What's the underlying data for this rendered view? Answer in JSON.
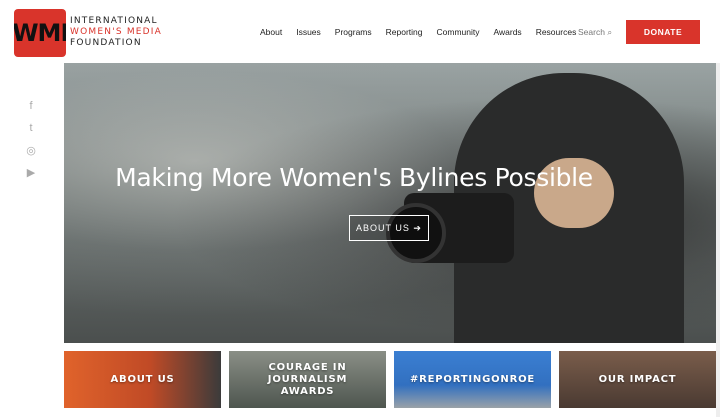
{
  "logo": {
    "letters": "IWMF",
    "line1": "INTERNATIONAL",
    "line2": "WOMEN'S MEDIA",
    "line3": "FOUNDATION"
  },
  "nav": {
    "items": [
      "About",
      "Issues",
      "Programs",
      "Reporting",
      "Community",
      "Awards",
      "Resources"
    ]
  },
  "search": {
    "label": "Search"
  },
  "donate": {
    "label": "DONATE"
  },
  "social": {
    "icons": [
      "facebook-icon",
      "twitter-icon",
      "instagram-icon",
      "youtube-icon"
    ]
  },
  "hero": {
    "title": "Making More Women's Bylines Possible",
    "button_label": "ABOUT US ➔"
  },
  "tiles": [
    {
      "label": "ABOUT US"
    },
    {
      "label": "COURAGE IN JOURNALISM AWARDS"
    },
    {
      "label": "#REPORTINGONROE"
    },
    {
      "label": "OUR IMPACT"
    }
  ],
  "colors": {
    "brand_red": "#d9342b"
  }
}
